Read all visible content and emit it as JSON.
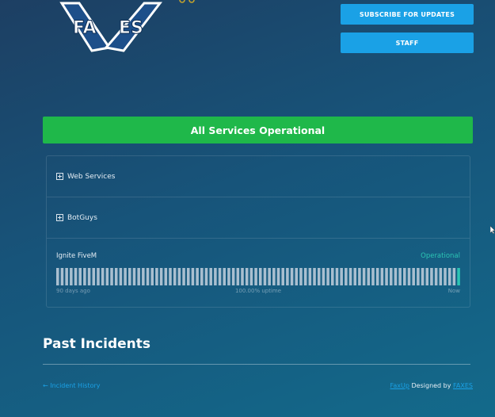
{
  "header": {
    "logo_letters": [
      "FA",
      "ES"
    ],
    "subscribe_label": "Subscribe for Updates",
    "staff_label": "Staff"
  },
  "status_banner": {
    "text": "All Services Operational",
    "color": "#1fb84a"
  },
  "components": {
    "groups": [
      {
        "label": "Web Services",
        "icon": "plus-square-icon"
      },
      {
        "label": "BotGuys",
        "icon": "plus-square-icon"
      }
    ],
    "component": {
      "name": "Ignite FiveM",
      "status": "Operational",
      "uptime": {
        "bar_count": 90,
        "left_caption": "90 days ago",
        "middle_caption": "100.00% uptime",
        "right_caption": "Now",
        "bar_color": "#a9bfd0",
        "today_color": "#2bc5b4"
      }
    }
  },
  "past_incidents": {
    "title": "Past Incidents",
    "history_link": "← Incident History"
  },
  "footer": {
    "brand": "FaxUp",
    "designed_by": "Designed by",
    "designer": "FAXES"
  },
  "colors": {
    "accent": "#1aa1e6",
    "operational": "#2bc5b4"
  }
}
